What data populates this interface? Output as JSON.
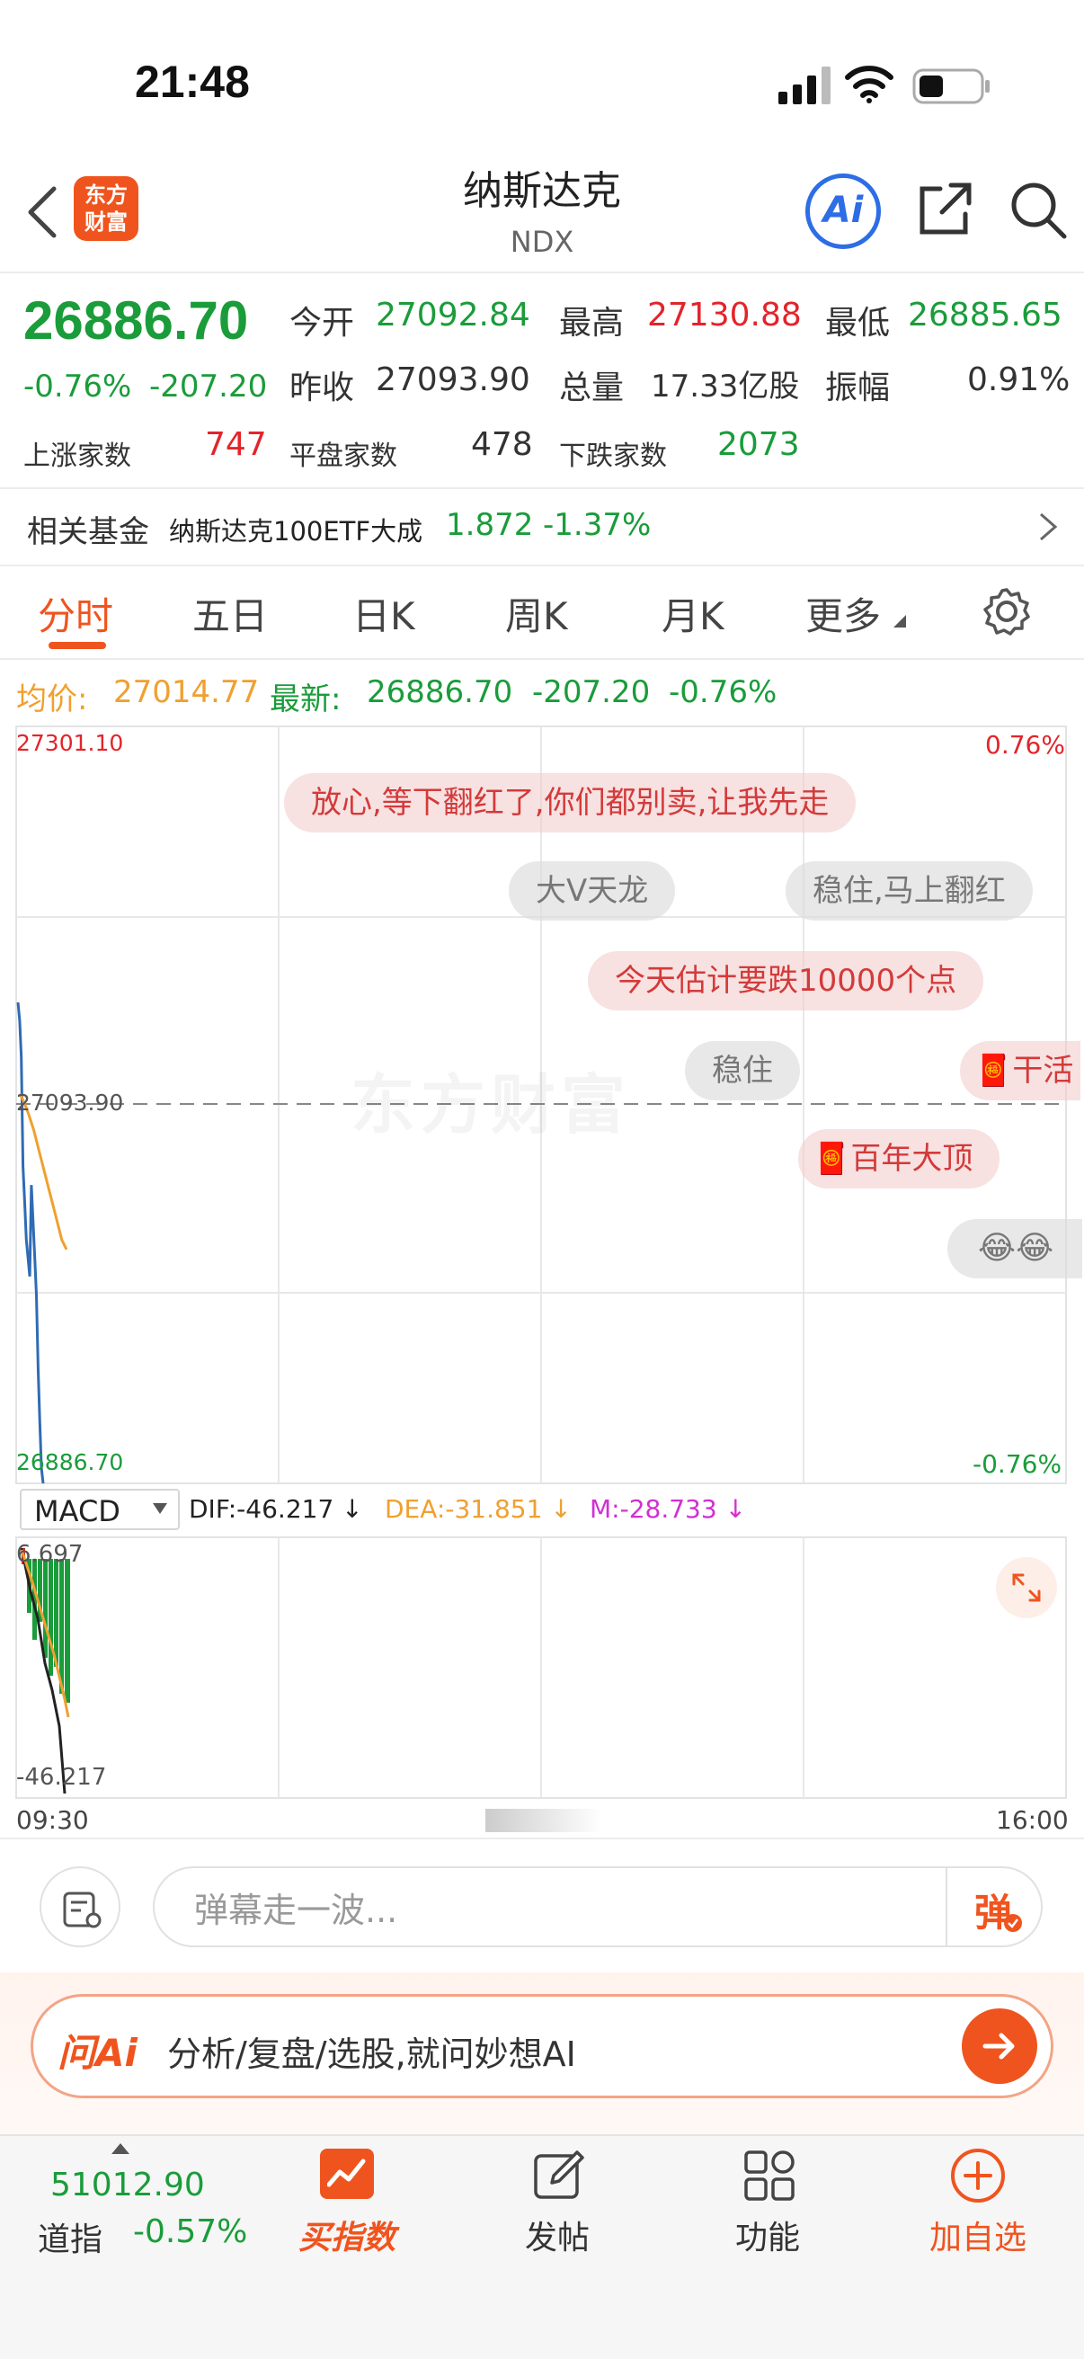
{
  "status_bar": {
    "time": "21:48"
  },
  "header": {
    "back_label": "back",
    "logo_text": "东方\n财富",
    "title": "纳斯达克",
    "subtitle": "NDX"
  },
  "quote": {
    "price": "26886.70",
    "change_pct": "-0.76%",
    "change_abs": "-207.20",
    "open_label": "今开",
    "open": "27092.84",
    "high_label": "最高",
    "high": "27130.88",
    "low_label": "最低",
    "low": "26885.65",
    "prev_close_label": "昨收",
    "prev_close": "27093.90",
    "volume_label": "总量",
    "volume": "17.33亿股",
    "amplitude_label": "振幅",
    "amplitude": "0.91%",
    "up_label": "上涨家数",
    "up_count": "747",
    "flat_label": "平盘家数",
    "flat_count": "478",
    "down_label": "下跌家数",
    "down_count": "2073"
  },
  "fund": {
    "label": "相关基金",
    "name": "纳斯达克100ETF大成",
    "price": "1.872",
    "change": "-1.37%"
  },
  "tabs": [
    {
      "label": "分时",
      "active": true
    },
    {
      "label": "五日"
    },
    {
      "label": "日K"
    },
    {
      "label": "周K"
    },
    {
      "label": "月K"
    },
    {
      "label": "更多"
    }
  ],
  "avg_bar": {
    "avg_label": "均价:",
    "avg_value": "27014.77",
    "latest_label": "最新:",
    "latest_value": "26886.70",
    "latest_change": "-207.20",
    "latest_pct": "-0.76%"
  },
  "chart": {
    "y_top": "27301.10",
    "y_mid": "27093.90",
    "y_bottom": "26886.70",
    "pct_top": "0.76%",
    "pct_bottom": "-0.76%",
    "x_start": "09:30",
    "x_end": "16:00",
    "watermark": "东方财富",
    "colors": {
      "price_line": "#2f6bb5",
      "avg_line": "#f0a030",
      "up": "#e3242b",
      "down": "#1a9c3a"
    }
  },
  "chart_data": {
    "type": "line",
    "xlabel": "",
    "ylabel": "",
    "ylim": [
      26886.7,
      27301.1
    ],
    "x_range": [
      "09:30",
      "16:00"
    ],
    "reference_line": 27093.9,
    "series": [
      {
        "values": [
          27150,
          27140,
          27120,
          27060,
          27040,
          27020,
          27010,
          27000,
          27050,
          27030,
          27010,
          26990,
          26950,
          26920,
          26895,
          26886.7
        ]
      },
      {
        "values": [
          27100,
          27095,
          27088,
          27080,
          27070,
          27060,
          27050,
          27040,
          27030,
          27020,
          27014.77
        ]
      }
    ]
  },
  "danmaku": [
    {
      "text": "放心,等下翻红了,你们都别卖,让我先走",
      "style": "pink"
    },
    {
      "text": "大V天龙",
      "style": "gray"
    },
    {
      "text": "稳住,马上翻红",
      "style": "gray"
    },
    {
      "text": "今天估计要跌10000个点",
      "style": "pink"
    },
    {
      "text": "稳住",
      "style": "gray"
    },
    {
      "text": "干活",
      "style": "pink",
      "icon": "firecracker-icon"
    },
    {
      "text": "百年大顶",
      "style": "pink",
      "icon": "firecracker-icon"
    }
  ],
  "macd": {
    "selector": "MACD",
    "dif": "DIF:-46.217 ↓",
    "dea": "DEA:-31.851 ↓",
    "m": "M:-28.733 ↓",
    "y_top": "6.697",
    "y_bottom": "-46.217",
    "colors": {
      "dif": "#222222",
      "dea": "#f0a030",
      "m": "#d22fd2"
    }
  },
  "input_bar": {
    "placeholder": "弹幕走一波...",
    "dan_label": "弹"
  },
  "ask_ai": {
    "logo": "问Ai",
    "text": "分析/复盘/选股,就问妙想AI"
  },
  "bottom_nav": {
    "ticker_value": "51012.90",
    "ticker_name": "道指",
    "ticker_change": "-0.57%",
    "items": [
      {
        "label": "买指数",
        "icon": "trend-chart-icon"
      },
      {
        "label": "发帖",
        "icon": "compose-icon"
      },
      {
        "label": "功能",
        "icon": "grid-icon"
      },
      {
        "label": "加自选",
        "icon": "plus-circle-icon"
      }
    ]
  }
}
